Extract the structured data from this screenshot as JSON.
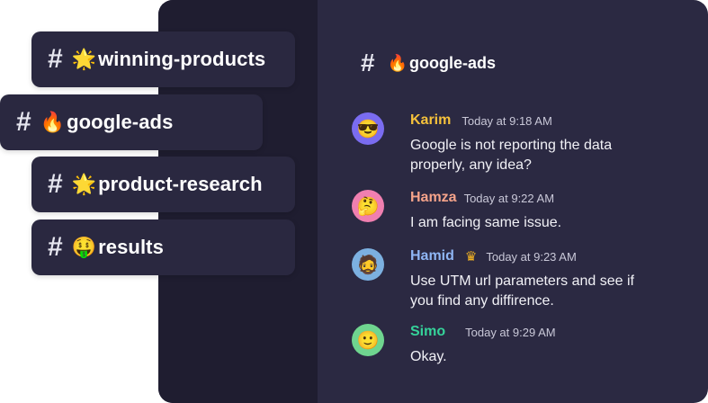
{
  "channels": [
    {
      "emoji": "🌟",
      "name": "winning-products"
    },
    {
      "emoji": "🔥",
      "name": "google-ads"
    },
    {
      "emoji": "🌟",
      "name": "product-research"
    },
    {
      "emoji": "🤑",
      "name": "results"
    }
  ],
  "hash_symbol": "#",
  "active_channel": {
    "emoji": "🔥",
    "name": "google-ads"
  },
  "messages": [
    {
      "user": "Karim",
      "user_color": "#f5c13b",
      "time": "Today at 9:18 AM",
      "text": "Google is not reporting the data properly, any idea?",
      "avatar_emoji": "😎"
    },
    {
      "user": "Hamza",
      "user_color": "#f5a38a",
      "time": "Today at 9:22 AM",
      "text": "I am facing same issue.",
      "avatar_emoji": "🤔"
    },
    {
      "user": "Hamid",
      "user_color": "#8fb6f5",
      "time": "Today at 9:23 AM",
      "text": "Use UTM url parameters and see if you find any diffirence.",
      "avatar_emoji": "🧔",
      "crown": "♛"
    },
    {
      "user": "Simo",
      "user_color": "#35d39a",
      "time": "Today at 9:29 AM",
      "text": "Okay.",
      "avatar_emoji": "🙂"
    }
  ],
  "colors": {
    "panel": "#2b2942",
    "sidebar": "#1f1d30",
    "pill": "#2a2840"
  }
}
